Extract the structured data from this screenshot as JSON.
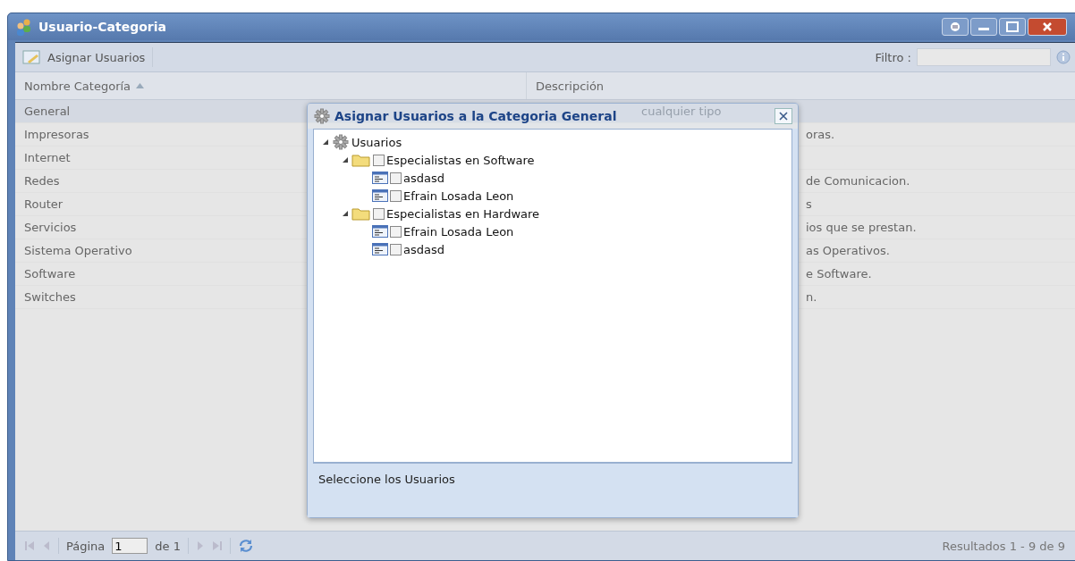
{
  "window": {
    "title": "Usuario-Categoria"
  },
  "toolbar": {
    "button": "Asignar Usuarios",
    "filter_label": "Filtro :"
  },
  "table": {
    "columns": [
      "Nombre Categoría",
      "Descripción"
    ],
    "rows": [
      {
        "name": "General",
        "description": "cualquier tipo",
        "selected": true
      },
      {
        "name": "Impresoras",
        "description": "oras.",
        "selected": false
      },
      {
        "name": "Internet",
        "selected": false
      },
      {
        "name": "Redes",
        "description": "de Comunicacion.",
        "selected": false
      },
      {
        "name": "Router",
        "description": "s",
        "selected": false
      },
      {
        "name": "Servicios",
        "description": "ios que se prestan.",
        "selected": false
      },
      {
        "name": "Sistema Operativo",
        "description": "as Operativos.",
        "selected": false
      },
      {
        "name": "Software",
        "description": "e Software.",
        "selected": false
      },
      {
        "name": "Switches",
        "description": "n.",
        "selected": false
      }
    ]
  },
  "dialog": {
    "title": "Asignar Usuarios a la Categoria General",
    "footer": "Seleccione los Usuarios",
    "tree": [
      {
        "label": "Usuarios",
        "kind": "root",
        "expanded": true,
        "children": [
          {
            "label": "Especialistas en Software",
            "kind": "folder",
            "expanded": true,
            "checked": false,
            "children": [
              {
                "label": "asdasd",
                "kind": "user",
                "checked": false
              },
              {
                "label": "Efrain Losada Leon",
                "kind": "user",
                "checked": false
              }
            ]
          },
          {
            "label": "Especialistas en Hardware",
            "kind": "folder",
            "expanded": true,
            "checked": false,
            "children": [
              {
                "label": "Efrain Losada Leon",
                "kind": "user",
                "checked": false
              },
              {
                "label": "asdasd",
                "kind": "user",
                "checked": false
              }
            ]
          }
        ]
      }
    ]
  },
  "paging": {
    "page_label": "Página",
    "page_value": "1",
    "of_label": "de 1",
    "results": "Resultados 1 - 9 de 9"
  }
}
